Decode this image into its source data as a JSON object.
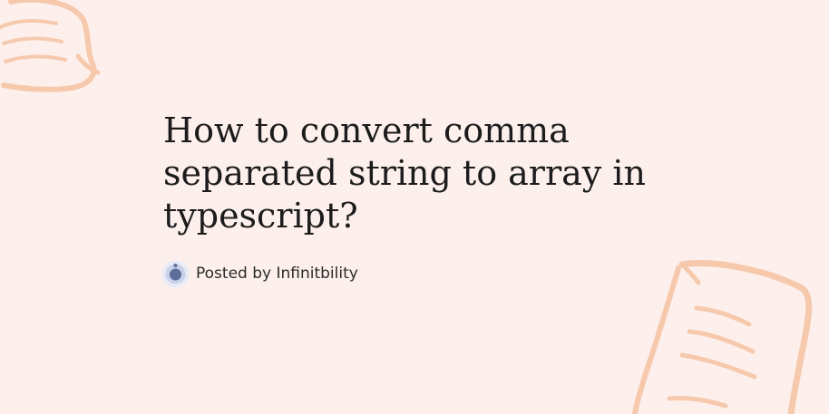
{
  "post": {
    "title": "How to convert comma separated string to array in typescript?",
    "byline": "Posted by Infinitbility"
  },
  "icons": {
    "avatar": "avatar-icon",
    "decoration": "note-sketch-icon"
  },
  "colors": {
    "background": "#fdf0ec",
    "sketch": "#f6c9ad",
    "avatar_ring": "#dbe2f3",
    "avatar_core": "#5d6e99"
  }
}
